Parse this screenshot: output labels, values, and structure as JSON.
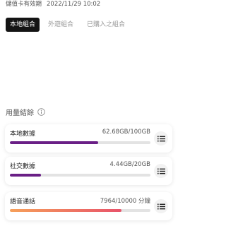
{
  "validity": {
    "label": "儲值卡有效期",
    "date": "2022/11/29 10:02"
  },
  "tabs": [
    {
      "label": "本地組合",
      "active": true
    },
    {
      "label": "外遊組合",
      "active": false
    },
    {
      "label": "已購入之組合",
      "active": false
    }
  ],
  "usage": {
    "title": "用量結餘",
    "items": [
      {
        "label": "本地數據",
        "value": "62.68GB/100GB",
        "fraction": 0.6268,
        "color": "#6a1f86"
      },
      {
        "label": "社交數據",
        "value": "4.44GB/20GB",
        "fraction": 0.222,
        "color": "#6a1f86"
      },
      {
        "label": "語音通話",
        "value": "7964/10000 分鐘",
        "fraction": 0.7964,
        "color_start": "#f6a05a",
        "color_end": "#e8536a"
      }
    ]
  },
  "icons": {
    "info": "info-circle-icon",
    "details": "list-details-icon"
  }
}
